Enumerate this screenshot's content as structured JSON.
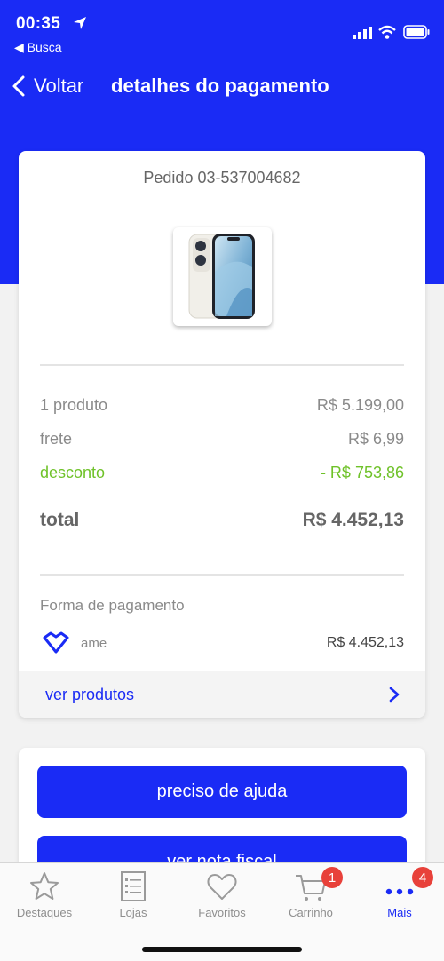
{
  "status_bar": {
    "time": "00:35",
    "back_app": "◀ Busca"
  },
  "header": {
    "back_label": "Voltar",
    "title": "detalhes do pagamento"
  },
  "order": {
    "number": "Pedido 03-537004682",
    "summary": {
      "products_label": "1 produto",
      "products_value": "R$ 5.199,00",
      "shipping_label": "frete",
      "shipping_value": "R$ 6,99",
      "discount_label": "desconto",
      "discount_value": "- R$ 753,86",
      "total_label": "total",
      "total_value": "R$ 4.452,13"
    },
    "payment": {
      "label": "Forma de pagamento",
      "method": "ame",
      "amount": "R$ 4.452,13"
    },
    "see_products": "ver produtos"
  },
  "actions": {
    "help": "preciso de ajuda",
    "invoice": "ver nota fiscal"
  },
  "tab_bar": {
    "items": [
      {
        "label": "Destaques",
        "icon": "star-icon"
      },
      {
        "label": "Lojas",
        "icon": "list-icon"
      },
      {
        "label": "Favoritos",
        "icon": "heart-icon"
      },
      {
        "label": "Carrinho",
        "icon": "cart-icon",
        "badge": "1"
      },
      {
        "label": "Mais",
        "icon": "more-icon",
        "badge": "4",
        "active": true
      }
    ]
  },
  "colors": {
    "brand_blue": "#1a2bf5",
    "discount_green": "#6fc229",
    "badge_red": "#e8413a"
  }
}
